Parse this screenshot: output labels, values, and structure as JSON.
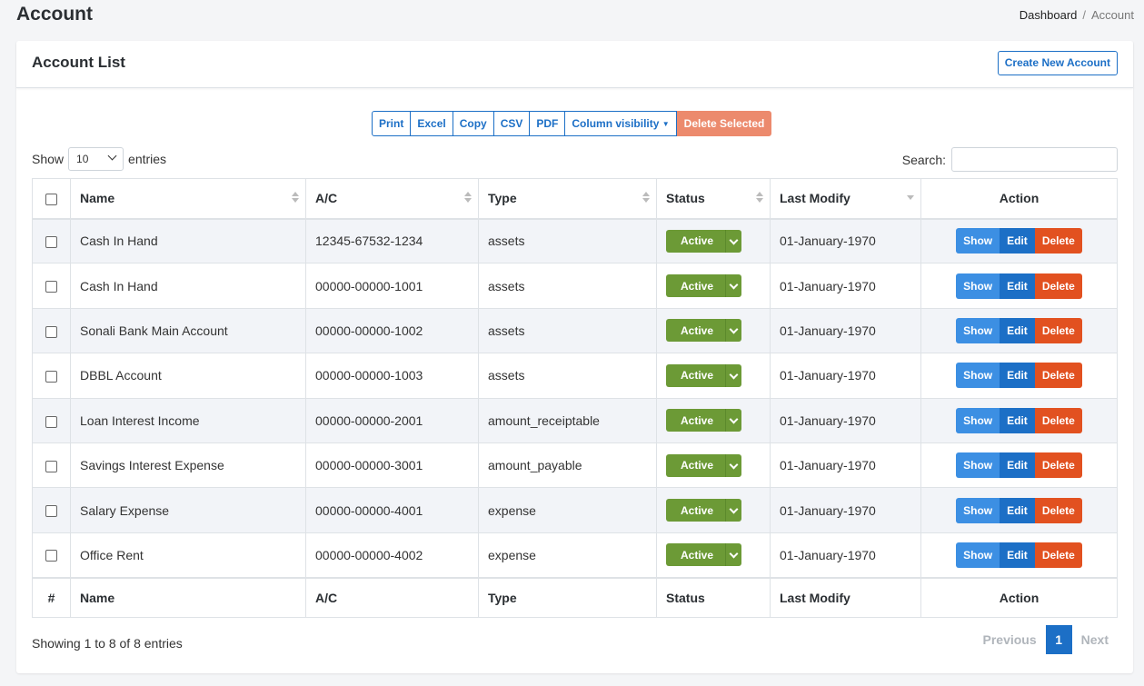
{
  "page": {
    "title": "Account",
    "breadcrumb": {
      "home": "Dashboard",
      "separator": "/",
      "current": "Account"
    }
  },
  "card": {
    "title": "Account List",
    "create_button": "Create New Account"
  },
  "export_buttons": {
    "print": "Print",
    "excel": "Excel",
    "copy": "Copy",
    "csv": "CSV",
    "pdf": "PDF",
    "column_visibility": "Column visibility",
    "delete_selected": "Delete Selected"
  },
  "length": {
    "show_label": "Show",
    "value": "10",
    "entries_label": "entries"
  },
  "search": {
    "label": "Search:",
    "value": ""
  },
  "table": {
    "headers": {
      "name": "Name",
      "ac": "A/C",
      "type": "Type",
      "status": "Status",
      "last_modify": "Last Modify",
      "action": "Action"
    },
    "footers": {
      "hash": "#",
      "name": "Name",
      "ac": "A/C",
      "type": "Type",
      "status": "Status",
      "last_modify": "Last Modify",
      "action": "Action"
    },
    "rows": [
      {
        "name": "Cash In Hand",
        "ac": "12345-67532-1234",
        "type": "assets",
        "status": "Active",
        "last_modify": "01-January-1970"
      },
      {
        "name": "Cash In Hand",
        "ac": "00000-00000-1001",
        "type": "assets",
        "status": "Active",
        "last_modify": "01-January-1970"
      },
      {
        "name": "Sonali Bank Main Account",
        "ac": "00000-00000-1002",
        "type": "assets",
        "status": "Active",
        "last_modify": "01-January-1970"
      },
      {
        "name": "DBBL Account",
        "ac": "00000-00000-1003",
        "type": "assets",
        "status": "Active",
        "last_modify": "01-January-1970"
      },
      {
        "name": "Loan Interest Income",
        "ac": "00000-00000-2001",
        "type": "amount_receiptable",
        "status": "Active",
        "last_modify": "01-January-1970"
      },
      {
        "name": "Savings Interest Expense",
        "ac": "00000-00000-3001",
        "type": "amount_payable",
        "status": "Active",
        "last_modify": "01-January-1970"
      },
      {
        "name": "Salary Expense",
        "ac": "00000-00000-4001",
        "type": "expense",
        "status": "Active",
        "last_modify": "01-January-1970"
      },
      {
        "name": "Office Rent",
        "ac": "00000-00000-4002",
        "type": "expense",
        "status": "Active",
        "last_modify": "01-January-1970"
      }
    ],
    "action_labels": {
      "show": "Show",
      "edit": "Edit",
      "delete": "Delete"
    }
  },
  "info": "Showing 1 to 8 of 8 entries",
  "pagination": {
    "previous": "Previous",
    "current_page": "1",
    "next": "Next"
  },
  "colors": {
    "primary": "#1c6fc6",
    "status_active": "#6c9a36",
    "delete": "#e25120",
    "show": "#3c8fe3",
    "delete_selected": "#ec8a6d"
  }
}
